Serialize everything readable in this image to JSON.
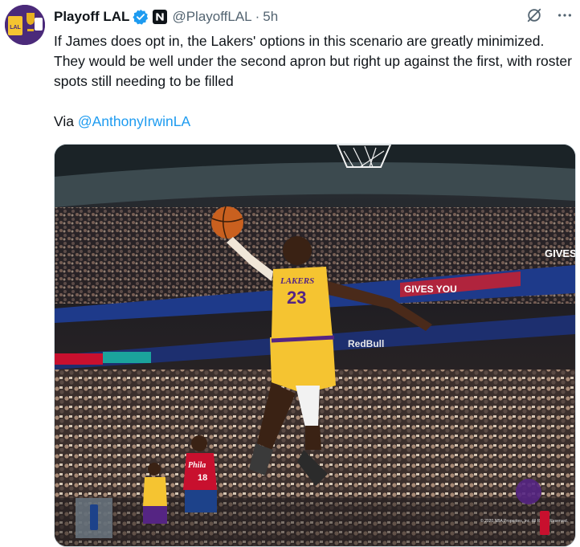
{
  "account": {
    "display_name": "Playoff LAL",
    "handle": "@PlayoffLAL",
    "separator": "·",
    "time": "5h",
    "avatar_text": "LAL"
  },
  "tweet": {
    "text": "If James does opt in, the Lakers' options in this scenario are greatly minimized. They would be well under the second apron but right up against the first, with roster spots still needing to be filled",
    "via_prefix": "Via",
    "via_mention": "@AnthonyIrwinLA"
  },
  "media": {
    "jersey_text": "LAKERS",
    "jersey_number": "23",
    "banner_text": "GIVES YOU",
    "banner_text_right": "GIVES Y",
    "sponsor_text": "RedBull",
    "opponent_jersey": "Phila",
    "opponent_number": "18",
    "watermark_text": "© 2020 NBA Properties, Inc. All Rights Reserved.",
    "colors": {
      "lakers_gold": "#f5c431",
      "lakers_purple": "#552583",
      "sixers_red": "#c8102e"
    }
  },
  "icons": {
    "verified": "verified-badge-icon",
    "affiliate": "affiliate-icon",
    "grok": "grok-icon",
    "more": "more-icon"
  }
}
